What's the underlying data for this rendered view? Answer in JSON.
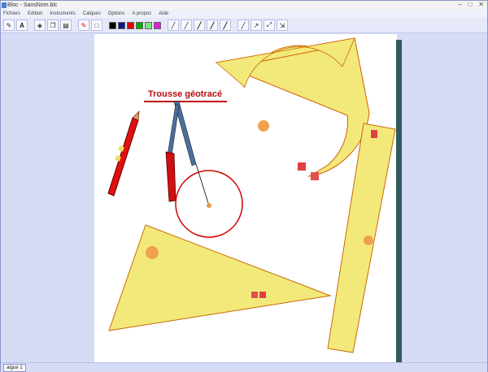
{
  "window": {
    "title": "Bloc - SansNom.blc",
    "minimize": "–",
    "maximize": "□",
    "close": "✕"
  },
  "menu": [
    "Fichiers",
    "Edition",
    "Instruments",
    "Calques",
    "Options",
    "A propos",
    "Aide"
  ],
  "drawing": {
    "title": "Trousse géotracé"
  },
  "colors": {
    "swatches": [
      "#000000",
      "#0a1a8a",
      "#e00000",
      "#00b000",
      "#7de77d",
      "#e020d0"
    ]
  },
  "tabs": {
    "active": "algue 1"
  }
}
